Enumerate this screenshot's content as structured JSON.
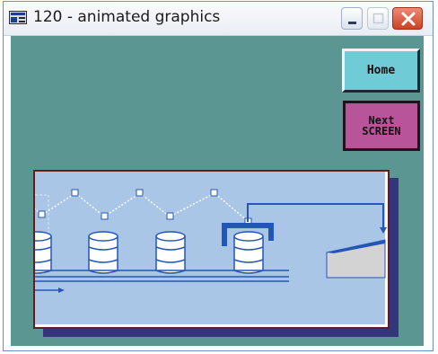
{
  "window": {
    "title": "120 - animated graphics",
    "icon": "window-app-icon",
    "controls": [
      "minimize-icon",
      "maximize-icon",
      "close-icon"
    ]
  },
  "buttons": {
    "home_label": "Home",
    "next_label_line1": "Next",
    "next_label_line2": "SCREEN"
  },
  "colors": {
    "client_background": "#5b9692",
    "scene_background": "#aac6e6",
    "line_blue": "#2456b7",
    "home_button": "#6fcbd6",
    "next_button": "#b8559a",
    "scene_shadow": "#34357a",
    "scene_border": "#6a1b1e"
  },
  "scene": {
    "description_items": [
      "conveyor-belt",
      "storage-drums",
      "pick-and-place-gripper",
      "motion-path-waypoints",
      "flow-direction-arrow",
      "loading-ramp"
    ]
  }
}
